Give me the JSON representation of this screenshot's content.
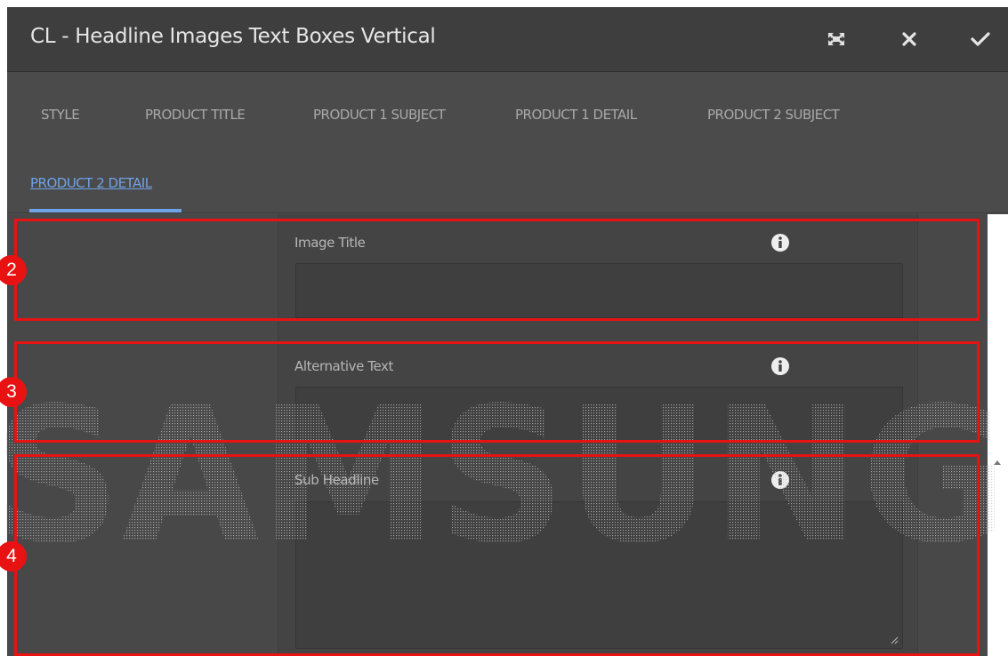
{
  "dialog": {
    "title": "CL - Headline Images Text Boxes Vertical",
    "actions": {
      "fullscreen_icon": "fullscreen-icon",
      "close_icon": "close-icon",
      "confirm_icon": "checkmark-icon"
    }
  },
  "tabs": [
    {
      "label": "STYLE",
      "active": false
    },
    {
      "label": "PRODUCT TITLE",
      "active": false
    },
    {
      "label": "PRODUCT 1 SUBJECT",
      "active": false
    },
    {
      "label": "PRODUCT 1 DETAIL",
      "active": false
    },
    {
      "label": "PRODUCT 2 SUBJECT",
      "active": false
    },
    {
      "label": "PRODUCT 2 DETAIL",
      "active": true
    }
  ],
  "fields": [
    {
      "label": "Image Title",
      "value": "",
      "type": "text",
      "info_icon": "info-icon"
    },
    {
      "label": "Alternative Text",
      "value": "",
      "type": "text",
      "info_icon": "info-icon"
    },
    {
      "label": "Sub Headline",
      "value": "",
      "type": "textarea",
      "info_icon": "info-icon"
    }
  ],
  "annotations": [
    {
      "number": "2"
    },
    {
      "number": "3"
    },
    {
      "number": "4"
    }
  ],
  "watermark": {
    "text": "SAMSUNG"
  },
  "colors": {
    "accent": "#6fa2e6",
    "annotation": "#e81212",
    "background": "#4b4b4b"
  }
}
